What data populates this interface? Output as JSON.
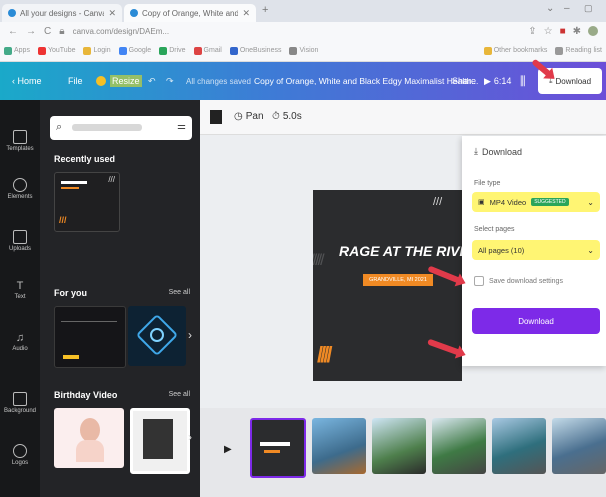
{
  "browser": {
    "tabs": [
      {
        "title": "All your designs - Canva"
      },
      {
        "title": "Copy of Orange, White and Bl..."
      }
    ],
    "url": "canva.com/design/DAEm..."
  },
  "bookmarks": [
    "Apps",
    "YouTube",
    "Login",
    "Google",
    "Drive",
    "Gmail",
    "OneBusiness",
    "Vision",
    "Other bookmarks",
    "Reading list"
  ],
  "header": {
    "home": "Home",
    "file": "File",
    "resize": "Resize",
    "saved": "All changes saved",
    "title": "Copy of Orange, White and Black Edgy Maximalist Health...",
    "share": "Share",
    "duration": "6:14",
    "download": "Download"
  },
  "rail": [
    "Templates",
    "Elements",
    "Uploads",
    "Text",
    "Audio",
    "Background",
    "Logos"
  ],
  "panel": {
    "recently_used": "Recently used",
    "for_you": "For you",
    "see_all": "See all",
    "birthday": "Birthday Video",
    "see_all2": "See all"
  },
  "toolbar": {
    "pan": "Pan",
    "time": "5.0s"
  },
  "download_panel": {
    "title": "Download",
    "file_type_label": "File type",
    "file_type_value": "MP4 Video",
    "badge": "SUGGESTED",
    "select_pages_label": "Select pages",
    "select_pages_value": "All pages (10)",
    "save_settings": "Save download settings",
    "button": "Download"
  },
  "design": {
    "headline": "RAGE AT THE RIVER",
    "subtitle": "GRANDVILLE, MI 2021"
  },
  "colors": {
    "accent_purple": "#7d2ae8",
    "header_start": "#1aa9c9",
    "header_end": "#6c4fd8",
    "annotation_red": "#e13a4a",
    "highlight_yellow": "#ffec00",
    "design_orange": "#f08a24"
  }
}
